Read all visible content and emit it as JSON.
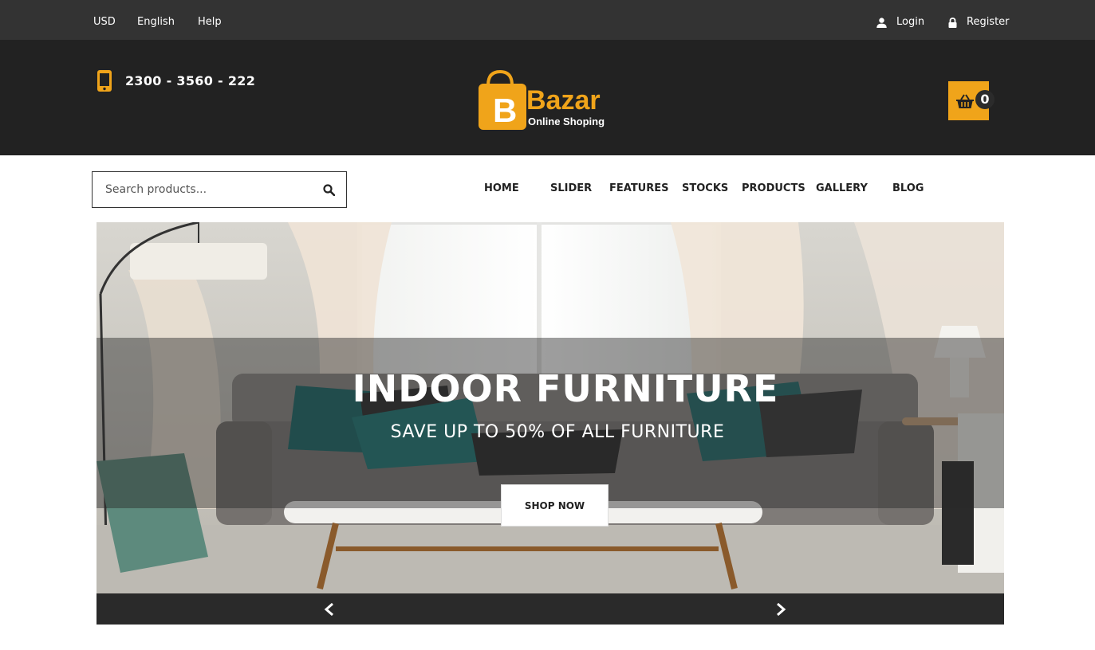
{
  "topbar": {
    "currency": "USD",
    "language": "English",
    "help": "Help",
    "login": "Login",
    "register": "Register"
  },
  "header": {
    "phone": "2300 - 3560 - 222",
    "logo_letter": "B",
    "logo_name": "Bazar",
    "logo_tagline": "Online Shoping",
    "cart_count": "0"
  },
  "search": {
    "placeholder": "Search products..."
  },
  "nav": {
    "items": [
      "HOME",
      "SLIDER",
      "FEATURES",
      "STOCKS",
      "PRODUCTS",
      "GALLERY",
      "BLOG"
    ]
  },
  "hero": {
    "title": "INDOOR FURNITURE",
    "subtitle": "SAVE UP TO 50% OF ALL FURNITURE",
    "button": "SHOP NOW"
  },
  "colors": {
    "accent": "#f0a41a",
    "topbar": "#333333",
    "header": "#222222"
  },
  "icons": [
    "user-icon",
    "lock-icon",
    "mobile-phone-icon",
    "basket-icon",
    "search-icon",
    "chevron-left-icon",
    "chevron-right-icon"
  ]
}
